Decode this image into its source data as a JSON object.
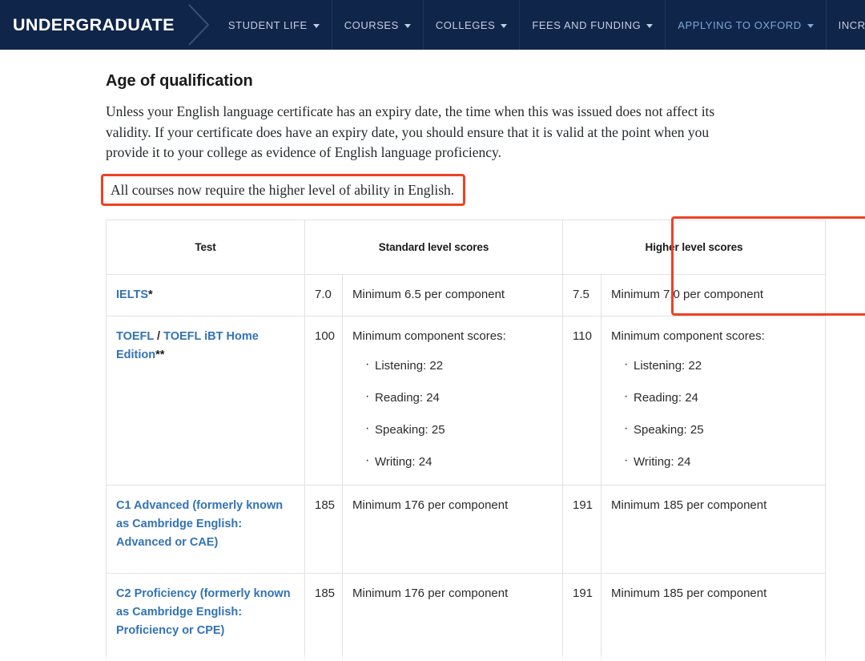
{
  "nav": {
    "brand": "UNDERGRADUATE",
    "items": [
      {
        "label": "STUDENT LIFE",
        "has_caret": true,
        "active": false
      },
      {
        "label": "COURSES",
        "has_caret": true,
        "active": false
      },
      {
        "label": "COLLEGES",
        "has_caret": true,
        "active": false
      },
      {
        "label": "FEES AND FUNDING",
        "has_caret": true,
        "active": false
      },
      {
        "label": "APPLYING TO OXFORD",
        "has_caret": true,
        "active": true
      },
      {
        "label": "INCREASING ACCESS",
        "has_caret": true,
        "active": false
      }
    ],
    "background_color": "#10254a",
    "active_color": "#7ba7d4",
    "text_color": "#c5cede"
  },
  "main": {
    "heading": "Age of qualification",
    "paragraph": "Unless your English language certificate has an expiry date, the time when this was issued does not affect its validity. If your certificate does have an expiry date, you should ensure that it is valid at the point when you provide it to your college as evidence of English language proficiency.",
    "callout": "All courses now require the higher level of ability in English.",
    "highlight_color": "#ef4123"
  },
  "table": {
    "headers": {
      "test": "Test",
      "standard": "Standard level scores",
      "higher": "Higher level scores"
    },
    "rows": [
      {
        "test_parts": [
          {
            "text": "IELTS",
            "type": "link"
          },
          {
            "text": "*",
            "type": "star"
          }
        ],
        "standard_score": "7.0",
        "standard_detail": "Minimum 6.5 per component",
        "standard_components": [],
        "higher_score": "7.5",
        "higher_detail": "Minimum 7.0 per component",
        "higher_components": []
      },
      {
        "test_parts": [
          {
            "text": "TOEFL",
            "type": "link"
          },
          {
            "text": " / ",
            "type": "slash"
          },
          {
            "text": "TOEFL iBT Home Edition",
            "type": "link"
          },
          {
            "text": "**",
            "type": "star"
          }
        ],
        "standard_score": "100",
        "standard_detail": "Minimum component scores:",
        "standard_components": [
          "Listening: 22",
          "Reading: 24",
          "Speaking: 25",
          "Writing: 24"
        ],
        "higher_score": "110",
        "higher_detail": "Minimum component scores:",
        "higher_components": [
          "Listening: 22",
          "Reading: 24",
          "Speaking: 25",
          "Writing: 24"
        ]
      },
      {
        "test_parts": [
          {
            "text": "C1 Advanced (formerly known as Cambridge English: Advanced or CAE)",
            "type": "link"
          }
        ],
        "standard_score": "185",
        "standard_detail": "Minimum 176 per component",
        "standard_components": [],
        "higher_score": "191",
        "higher_detail": "Minimum 185 per component",
        "higher_components": []
      },
      {
        "test_parts": [
          {
            "text": "C2 Proficiency (formerly known as Cambridge English: Proficiency or CPE)",
            "type": "link"
          }
        ],
        "standard_score": "185",
        "standard_detail": "Minimum 176 per component",
        "standard_components": [],
        "higher_score": "191",
        "higher_detail": "Minimum 185 per component",
        "higher_components": []
      }
    ]
  }
}
